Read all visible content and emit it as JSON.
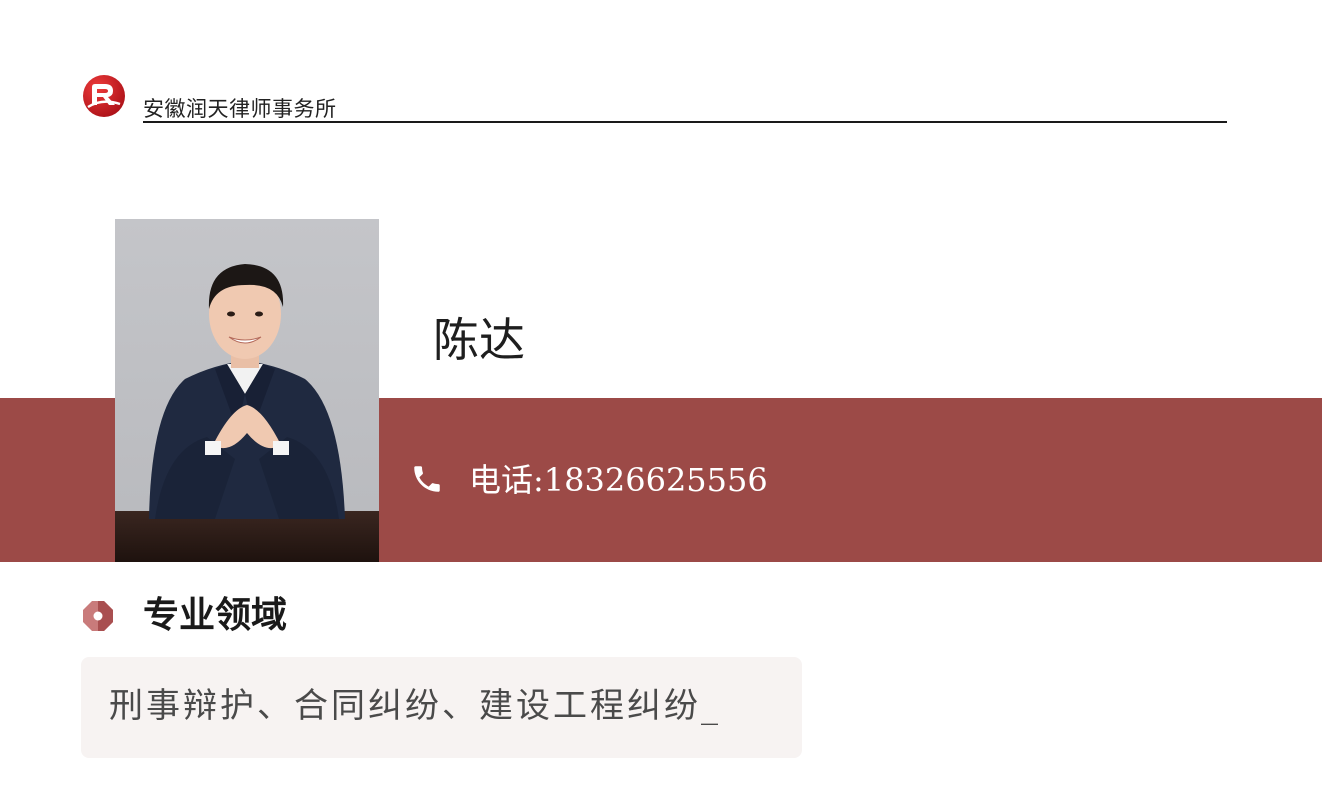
{
  "header": {
    "firm_name": "安徽润天律师事务所",
    "logo_icon": "firm-logo-icon"
  },
  "profile": {
    "name": "陈达",
    "phone_label": "电话:18326625556",
    "phone_icon": "phone-icon",
    "photo": "lawyer-portrait"
  },
  "specialty": {
    "title": "专业领域",
    "icon": "octagon-badge-icon",
    "text": "刑事辩护、合同纠纷、建设工程纠纷_"
  },
  "colors": {
    "band": "#9c4a47",
    "accent": "#c0392b",
    "box_bg": "#f7f3f2"
  }
}
